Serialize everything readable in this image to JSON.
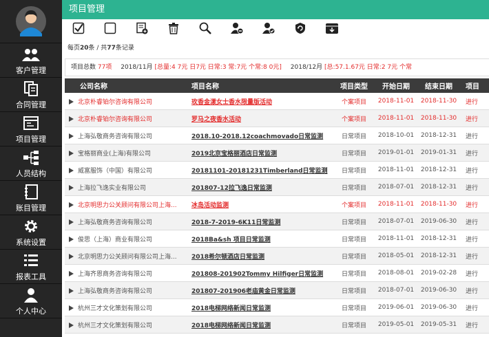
{
  "sidebar": {
    "items": [
      {
        "label": "客户管理",
        "icon": "users-icon"
      },
      {
        "label": "合同管理",
        "icon": "contract-icon"
      },
      {
        "label": "项目管理",
        "icon": "project-icon"
      },
      {
        "label": "人员结构",
        "icon": "org-structure-icon"
      },
      {
        "label": "账目管理",
        "icon": "ledger-icon"
      },
      {
        "label": "系统设置",
        "icon": "gear-icon"
      },
      {
        "label": "报表工具",
        "icon": "list-icon"
      },
      {
        "label": "个人中心",
        "icon": "person-icon"
      }
    ]
  },
  "header": {
    "title": "项目管理"
  },
  "toolbar": [
    "check-all-icon",
    "uncheck-icon",
    "add-document-icon",
    "trash-icon",
    "search-icon",
    "remove-user-icon",
    "approve-user-icon",
    "refresh-shield-icon",
    "archive-icon"
  ],
  "count": {
    "prefix": "每页",
    "per_page": "20",
    "mid": "条 / 共",
    "total": "77",
    "suffix": "条记录"
  },
  "summary": {
    "label": "项目总数",
    "total": "77项",
    "month1": "2018/11月",
    "month1_detail": "[总量:4 7元 日7元 日常:3 常:7元 个常:8 0元]",
    "month2": "2018/12月",
    "month2_detail": "[总:57.1.67元 日常:2 7元 个常"
  },
  "table": {
    "headers": [
      "公司名称",
      "项目名称",
      "项目类型",
      "开始日期",
      "结束日期",
      "项目"
    ],
    "rows": [
      {
        "company": "北京朴睿铂尔咨询有限公司",
        "project": "玫香金漾女士香水限量版活动",
        "type": "个案项目",
        "start": "2018-11-01",
        "end": "2018-11-30",
        "status": "进行",
        "hot": true
      },
      {
        "company": "北京朴睿铂尔咨询有限公司",
        "project": "罗马之夜香水活动",
        "type": "个案项目",
        "start": "2018-11-01",
        "end": "2018-11-30",
        "status": "进行",
        "hot": true
      },
      {
        "company": "上海弘敬商务咨询有限公司",
        "project": "2018.10-2018.12coachmovado日常监测",
        "type": "日常项目",
        "start": "2018-10-01",
        "end": "2018-12-31",
        "status": "进行",
        "hot": false
      },
      {
        "company": "宝格丽商业(上海)有限公司",
        "project": "2019北京宝格丽酒店日常监测",
        "type": "日常项目",
        "start": "2019-01-01",
        "end": "2019-01-31",
        "status": "进行",
        "hot": false
      },
      {
        "company": "威富服饰（中国）有限公司",
        "project": "20181101-20181231Timberland日常监测",
        "type": "日常项目",
        "start": "2018-11-01",
        "end": "2018-12-31",
        "status": "进行",
        "hot": false
      },
      {
        "company": "上海拉飞逸实业有限公司",
        "project": "201807-12拉飞逸日常监测",
        "type": "日常项目",
        "start": "2018-07-01",
        "end": "2018-12-31",
        "status": "进行",
        "hot": false
      },
      {
        "company": "北京明思力公关顾问有限公司上海...",
        "project": "冰岛活动监测",
        "type": "个案项目",
        "start": "2018-11-01",
        "end": "2018-11-30",
        "status": "进行",
        "hot": true
      },
      {
        "company": "上海弘敬商务咨询有限公司",
        "project": "2018-7-2019-6K11日常监测",
        "type": "日常项目",
        "start": "2018-07-01",
        "end": "2019-06-30",
        "status": "进行",
        "hot": false
      },
      {
        "company": "俊思（上海）商业有限公司",
        "project": "2018Ba&sh 项目日常监测",
        "type": "日常项目",
        "start": "2018-11-01",
        "end": "2018-12-31",
        "status": "进行",
        "hot": false
      },
      {
        "company": "北京明思力公关顾问有限公司上海...",
        "project": "2018希尔顿酒店日常监测",
        "type": "日常项目",
        "start": "2018-05-01",
        "end": "2018-12-31",
        "status": "进行",
        "hot": false
      },
      {
        "company": "上海齐恩商务咨询有限公司",
        "project": "201808-201902Tommy Hilfiger日常监测",
        "type": "日常项目",
        "start": "2018-08-01",
        "end": "2019-02-28",
        "status": "进行",
        "hot": false
      },
      {
        "company": "上海弘敬商务咨询有限公司",
        "project": "201807-201906老庙黄金日常监测",
        "type": "日常项目",
        "start": "2018-07-01",
        "end": "2019-06-30",
        "status": "进行",
        "hot": false
      },
      {
        "company": "杭州三才文化策划有限公司",
        "project": "2018电梯网络新闻日常监测",
        "type": "日常项目",
        "start": "2019-06-01",
        "end": "2019-06-30",
        "status": "进行",
        "hot": false
      },
      {
        "company": "杭州三才文化策划有限公司",
        "project": "2018电梯网络新闻日常监测",
        "type": "日常项目",
        "start": "2019-05-01",
        "end": "2019-05-31",
        "status": "进行",
        "hot": false
      }
    ]
  }
}
